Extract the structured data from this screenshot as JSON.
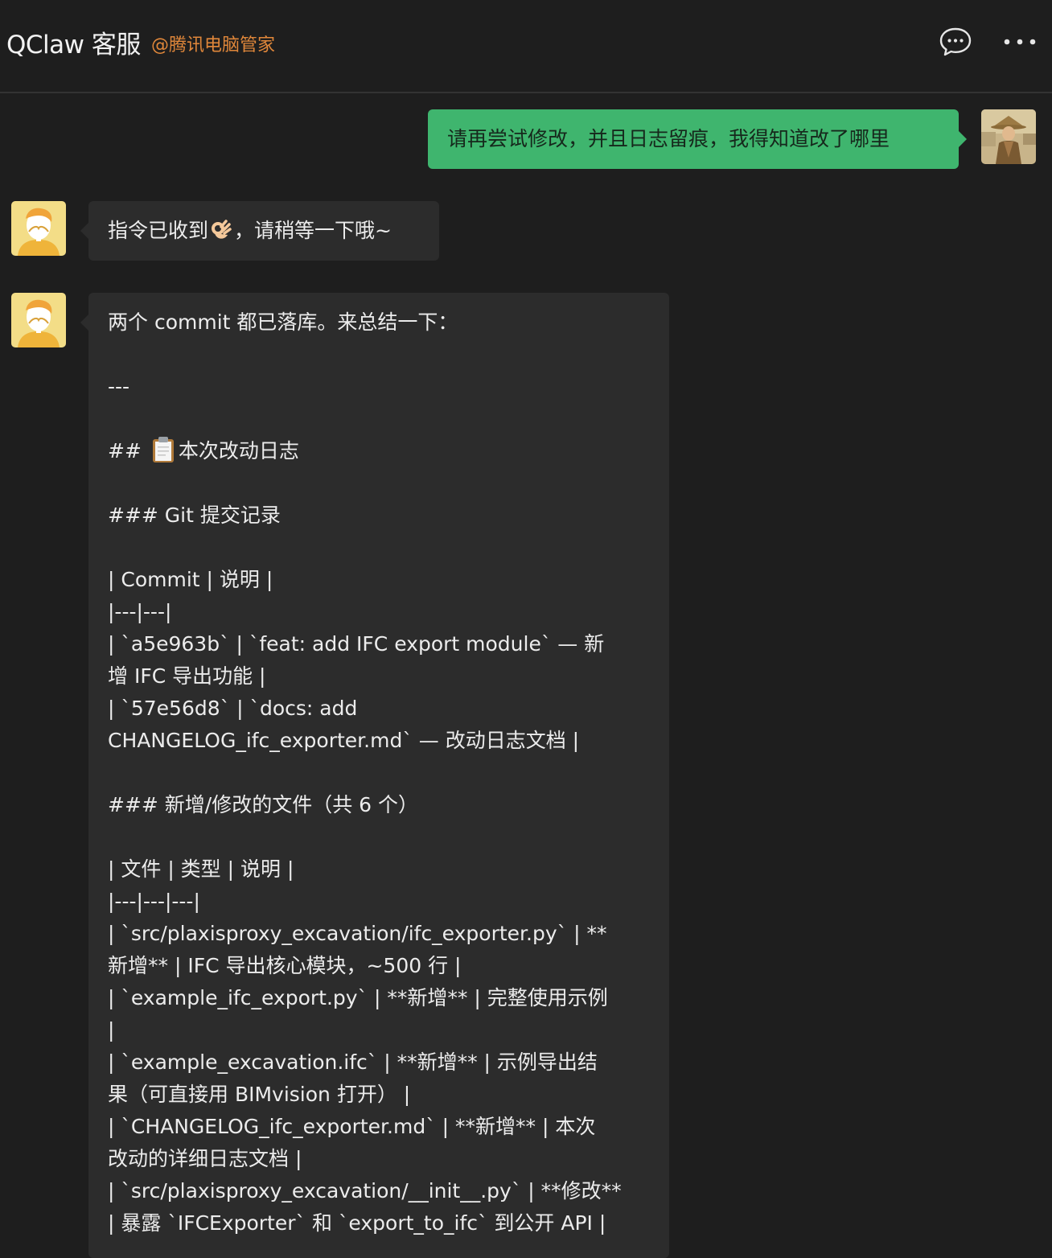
{
  "header": {
    "title": "QClaw 客服",
    "subtitle": "@腾讯电脑管家",
    "chat_icon": "chat-bubble-icon",
    "more_icon": "more-dots-icon"
  },
  "messages": {
    "user_1": {
      "text": "请再尝试修改，并且日志留痕，我得知道改了哪里"
    },
    "bot_1": {
      "text_before": "指令已收到",
      "emoji": "ok-hand",
      "text_after": "，请稍等一下哦~"
    },
    "bot_2": {
      "line_01": "两个 commit 都已落库。来总结一下：",
      "line_02": "",
      "line_03": "---",
      "line_04": "",
      "line_05_prefix": "## ",
      "line_05_emoji": "clipboard",
      "line_05_text": "本次改动日志",
      "line_06": "",
      "line_07": "### Git 提交记录",
      "line_08": "",
      "line_09": "| Commit | 说明 |",
      "line_10": "|---|---|",
      "line_11": "| `a5e963b` | `feat: add IFC export module` — 新",
      "line_12": "增 IFC 导出功能 |",
      "line_13": "| `57e56d8` | `docs: add",
      "line_14": "CHANGELOG_ifc_exporter.md` — 改动日志文档 |",
      "line_15": "",
      "line_16": "### 新增/修改的文件（共 6 个）",
      "line_17": "",
      "line_18": "| 文件 | 类型 | 说明 |",
      "line_19": "|---|---|---|",
      "line_20": "| `src/plaxisproxy_excavation/ifc_exporter.py` | **",
      "line_21": "新增** | IFC 导出核心模块，~500 行 |",
      "line_22": "| `example_ifc_export.py` | **新增** | 完整使用示例",
      "line_23": "|",
      "line_24": "| `example_excavation.ifc` | **新增** | 示例导出结",
      "line_25": "果（可直接用 BIMvision 打开） |",
      "line_26": "| `CHANGELOG_ifc_exporter.md` | **新增** | 本次",
      "line_27": "改动的详细日志文档 |",
      "line_28": "| `src/plaxisproxy_excavation/__init__.py` | **修改**",
      "line_29": "| 暴露 `IFCExporter` 和 `export_to_ifc` 到公开 API |"
    }
  },
  "colors": {
    "background": "#1e1e1e",
    "user_bubble": "#3fb56e",
    "bot_bubble": "#2c2c2c",
    "subtitle": "#e0873a"
  }
}
